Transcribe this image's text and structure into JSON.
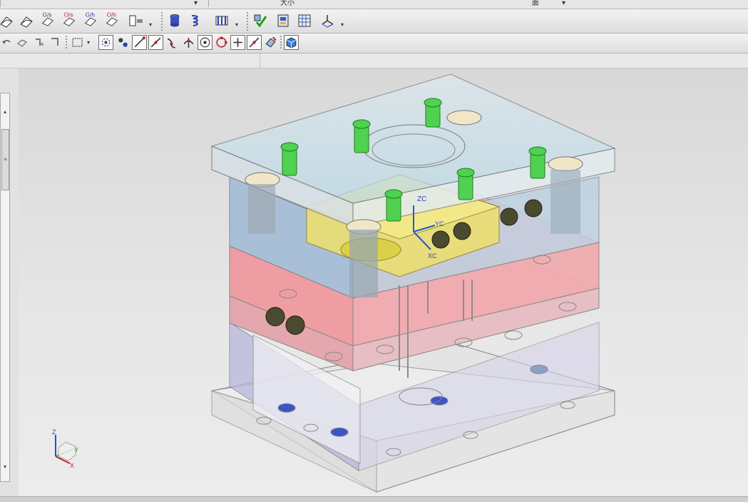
{
  "top_strip": {
    "field_left": "",
    "field_mid_label": "大小",
    "field_right_label": "面"
  },
  "toolbar_row1": {
    "buttons": [
      {
        "name": "extrude-1-icon",
        "text": ""
      },
      {
        "name": "extrude-2-icon",
        "text": ""
      },
      {
        "name": "gs-icon",
        "text": "G/s"
      },
      {
        "name": "os-icon",
        "text": "O/s"
      },
      {
        "name": "gh-icon",
        "text": "G/h"
      },
      {
        "name": "oh-icon",
        "text": "O/h"
      },
      {
        "name": "fillet-chain-icon",
        "text": ""
      },
      {
        "name": "cylinder-icon",
        "text": ""
      },
      {
        "name": "spring-icon",
        "text": ""
      },
      {
        "name": "ejector-icon",
        "text": ""
      },
      {
        "name": "check-tool-icon",
        "text": ""
      },
      {
        "name": "assembly-tool-icon",
        "text": ""
      },
      {
        "name": "grid-tool-icon",
        "text": ""
      },
      {
        "name": "datum-csys-icon",
        "text": ""
      }
    ]
  },
  "toolbar_row2": {
    "buttons": [
      {
        "name": "undo-icon"
      },
      {
        "name": "shaded-icon"
      },
      {
        "name": "hide-icon"
      },
      {
        "name": "measure-icon"
      },
      {
        "name": "select-box-icon"
      },
      {
        "name": "snap-points-icon"
      },
      {
        "name": "snap-nodes-icon"
      },
      {
        "name": "snap-line-icon"
      },
      {
        "name": "snap-midpoint-icon"
      },
      {
        "name": "snap-curve-icon"
      },
      {
        "name": "snap-intersection-icon"
      },
      {
        "name": "snap-center-icon"
      },
      {
        "name": "snap-quadrant-icon"
      },
      {
        "name": "snap-cross-icon"
      },
      {
        "name": "snap-tangent-icon"
      },
      {
        "name": "snap-face-icon"
      },
      {
        "name": "view-cube-icon"
      }
    ]
  },
  "viewport": {
    "wcs_labels": {
      "zc": "ZC",
      "yc": "YC",
      "xc": "XC"
    },
    "triad_labels": {
      "z": "Z",
      "y": "Y",
      "x": "X"
    }
  },
  "colors": {
    "top_plate": "#cfe6f0",
    "cavity": "#f0a6a6",
    "core": "#e3b2b4",
    "side_plate": "#a8bfd8",
    "base_plate": "#dedede",
    "guide_pin": "#33cc33",
    "slider": "#efe06a"
  }
}
